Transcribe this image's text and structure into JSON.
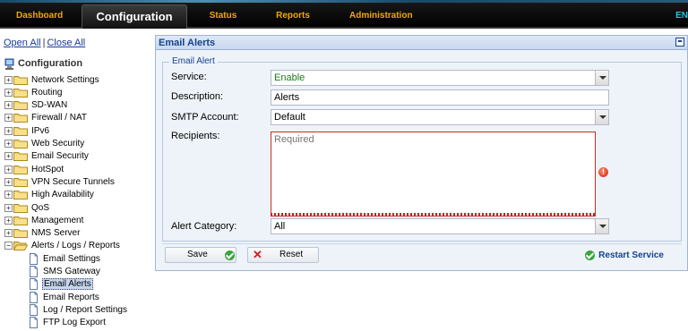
{
  "topnav": {
    "tabs": [
      {
        "label": "Dashboard"
      },
      {
        "label": "Configuration"
      },
      {
        "label": "Status"
      },
      {
        "label": "Reports"
      },
      {
        "label": "Administration"
      }
    ],
    "lang": "EN"
  },
  "sidebar": {
    "open_all": "Open All",
    "separator": "|",
    "close_all": "Close All",
    "root": "Configuration",
    "folders": [
      "Network Settings",
      "Routing",
      "SD-WAN",
      "Firewall / NAT",
      "IPv6",
      "Web Security",
      "Email Security",
      "HotSpot",
      "VPN Secure Tunnels",
      "High Availability",
      "QoS",
      "Management",
      "NMS Server"
    ],
    "open_folder": "Alerts / Logs / Reports",
    "children": [
      "Email Settings",
      "SMS Gateway",
      "Email Alerts",
      "Email Reports",
      "Log / Report Settings",
      "FTP Log Export"
    ]
  },
  "panel": {
    "title": "Email Alerts",
    "legend": "Email Alert",
    "fields": {
      "service_label": "Service:",
      "service_value": "Enable",
      "description_label": "Description:",
      "description_value": "Alerts",
      "smtp_label": "SMTP Account:",
      "smtp_value": "Default",
      "recipients_label": "Recipients:",
      "recipients_placeholder": "Required",
      "category_label": "Alert Category:",
      "category_value": "All"
    },
    "save_label": "Save",
    "reset_label": "Reset",
    "restart_label": "Restart Service"
  },
  "colors": {
    "nav_accent": "#f0a800",
    "panel_title": "#15428b",
    "enable_green": "#1a7a1a",
    "error_red": "#c03020"
  }
}
